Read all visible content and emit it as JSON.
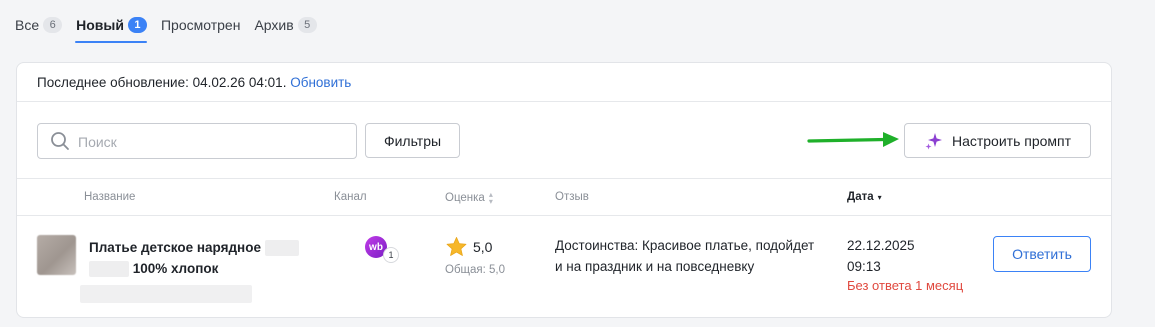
{
  "tabs": [
    {
      "label": "Все",
      "count": "6"
    },
    {
      "label": "Новый",
      "count": "1"
    },
    {
      "label": "Просмотрен",
      "count": ""
    },
    {
      "label": "Архив",
      "count": "5"
    }
  ],
  "colors": {
    "accent": "#3b82f6",
    "link": "#2f6fd6",
    "warning": "#e0493f",
    "arrow": "#1fb02a",
    "sparkle": "#8b3fd1"
  },
  "update": {
    "label": "Последнее обновление: 04.02.26 04:01.",
    "refresh": "Обновить"
  },
  "toolbar": {
    "search_placeholder": "Поиск",
    "filters": "Фильтры",
    "prompt": "Настроить промпт"
  },
  "table": {
    "headers": {
      "name": "Название",
      "channel": "Канал",
      "rating": "Оценка",
      "review": "Отзыв",
      "date": "Дата"
    },
    "row": {
      "name_line1": "Платье детское нарядное",
      "name_line2": "100% хлопок",
      "channel_icon": "wb",
      "channel_count": "1",
      "rating": "5,0",
      "rating_total": "Общая: 5,0",
      "review": "Достоинства: Красивое платье, подойдет и на праздник и на повседневку",
      "date": "22.12.2025",
      "time": "09:13",
      "status": "Без ответа 1 месяц",
      "reply": "Ответить"
    }
  }
}
